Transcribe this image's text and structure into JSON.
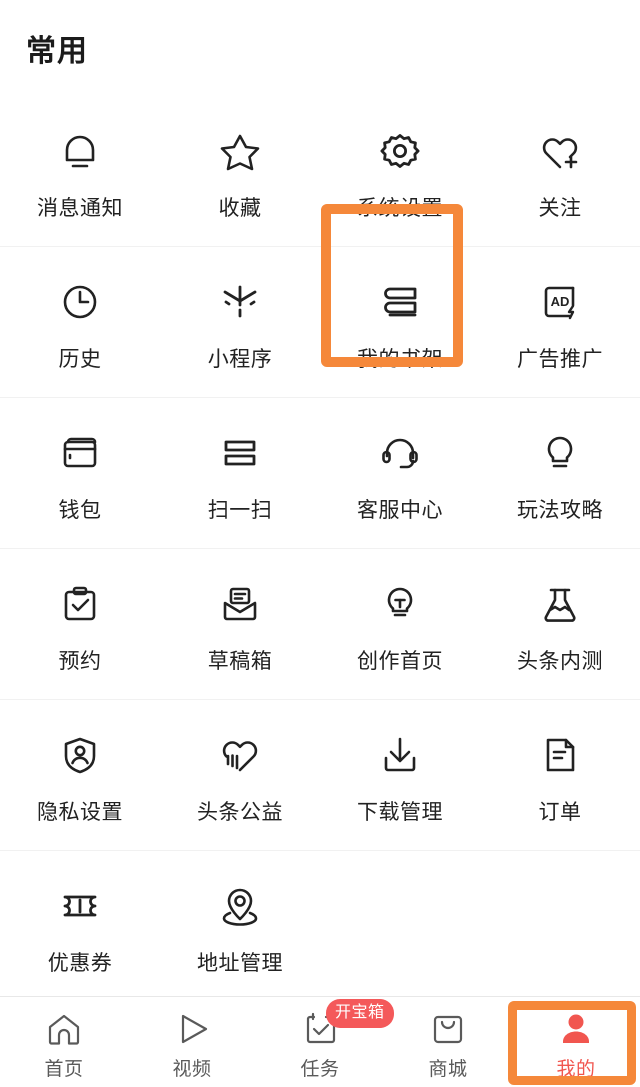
{
  "header": {
    "title": "常用"
  },
  "colors": {
    "highlight_orange": "#f5883a",
    "badge_red": "#f4595a",
    "active_red": "#f1564f",
    "icon_stroke": "#222222",
    "label_text": "#222222"
  },
  "grid": {
    "highlighted_item": "系统设置",
    "rows": [
      [
        {
          "label": "消息通知",
          "icon": "bell-icon"
        },
        {
          "label": "收藏",
          "icon": "star-icon"
        },
        {
          "label": "系统设置",
          "icon": "gear-icon"
        },
        {
          "label": "关注",
          "icon": "heart-plus-icon"
        }
      ],
      [
        {
          "label": "历史",
          "icon": "clock-icon"
        },
        {
          "label": "小程序",
          "icon": "mini-program-icon"
        },
        {
          "label": "我的书架",
          "icon": "bookshelf-icon"
        },
        {
          "label": "广告推广",
          "icon": "ad-icon"
        }
      ],
      [
        {
          "label": "钱包",
          "icon": "wallet-icon"
        },
        {
          "label": "扫一扫",
          "icon": "scan-icon"
        },
        {
          "label": "客服中心",
          "icon": "headset-icon"
        },
        {
          "label": "玩法攻略",
          "icon": "lightbulb-icon"
        }
      ],
      [
        {
          "label": "预约",
          "icon": "clipboard-check-icon"
        },
        {
          "label": "草稿箱",
          "icon": "draft-envelope-icon"
        },
        {
          "label": "创作首页",
          "icon": "bulb-text-icon"
        },
        {
          "label": "头条内测",
          "icon": "flask-icon"
        }
      ],
      [
        {
          "label": "隐私设置",
          "icon": "shield-person-icon"
        },
        {
          "label": "头条公益",
          "icon": "heart-hand-icon"
        },
        {
          "label": "下载管理",
          "icon": "download-icon"
        },
        {
          "label": "订单",
          "icon": "document-icon"
        }
      ],
      [
        {
          "label": "优惠券",
          "icon": "coupon-ticket-icon"
        },
        {
          "label": "地址管理",
          "icon": "location-pin-icon"
        },
        {
          "label": "",
          "icon": ""
        },
        {
          "label": "",
          "icon": ""
        }
      ]
    ]
  },
  "bottom_nav": {
    "active_item": "我的",
    "items": [
      {
        "label": "首页",
        "icon": "home-icon",
        "badge": ""
      },
      {
        "label": "视频",
        "icon": "play-icon",
        "badge": ""
      },
      {
        "label": "任务",
        "icon": "task-check-icon",
        "badge": "开宝箱"
      },
      {
        "label": "商城",
        "icon": "shopping-bag-icon",
        "badge": ""
      },
      {
        "label": "我的",
        "icon": "person-icon",
        "badge": ""
      }
    ]
  }
}
